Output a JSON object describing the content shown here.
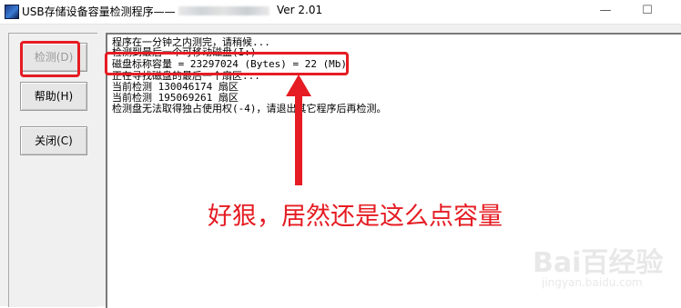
{
  "window": {
    "title_prefix": "USB存储设备容量检测程序——",
    "title_version": "Ver 2.01",
    "minimize_glyph": "—",
    "maximize_glyph": "☐"
  },
  "buttons": {
    "detect_label": "检测(D)",
    "help_label": "帮助(H)",
    "close_label": "关闭(C)"
  },
  "log": {
    "lines": [
      "程序在一分钟之内测完，请稍候...",
      "检测到最后一个可移动磁盘(I:)",
      "磁盘标称容量 = 23297024 (Bytes) = 22 (Mb)",
      "正在寻找磁盘的最后一个扇区...",
      "当前检测 130046174 扇区",
      "当前检测 195069261 扇区",
      "检测盘无法取得独占使用权(-4)，请退出其它程序后再检测。"
    ]
  },
  "annotation": {
    "text": "好狠，居然还是这么点容量",
    "color": "#e51c23"
  },
  "watermark": {
    "text": "Bai百经验",
    "sub": "jingyan.baidu.com"
  },
  "colors": {
    "accent_red": "#e51c23",
    "window_bg": "#f0f0f0",
    "log_bg": "#ffffff"
  }
}
